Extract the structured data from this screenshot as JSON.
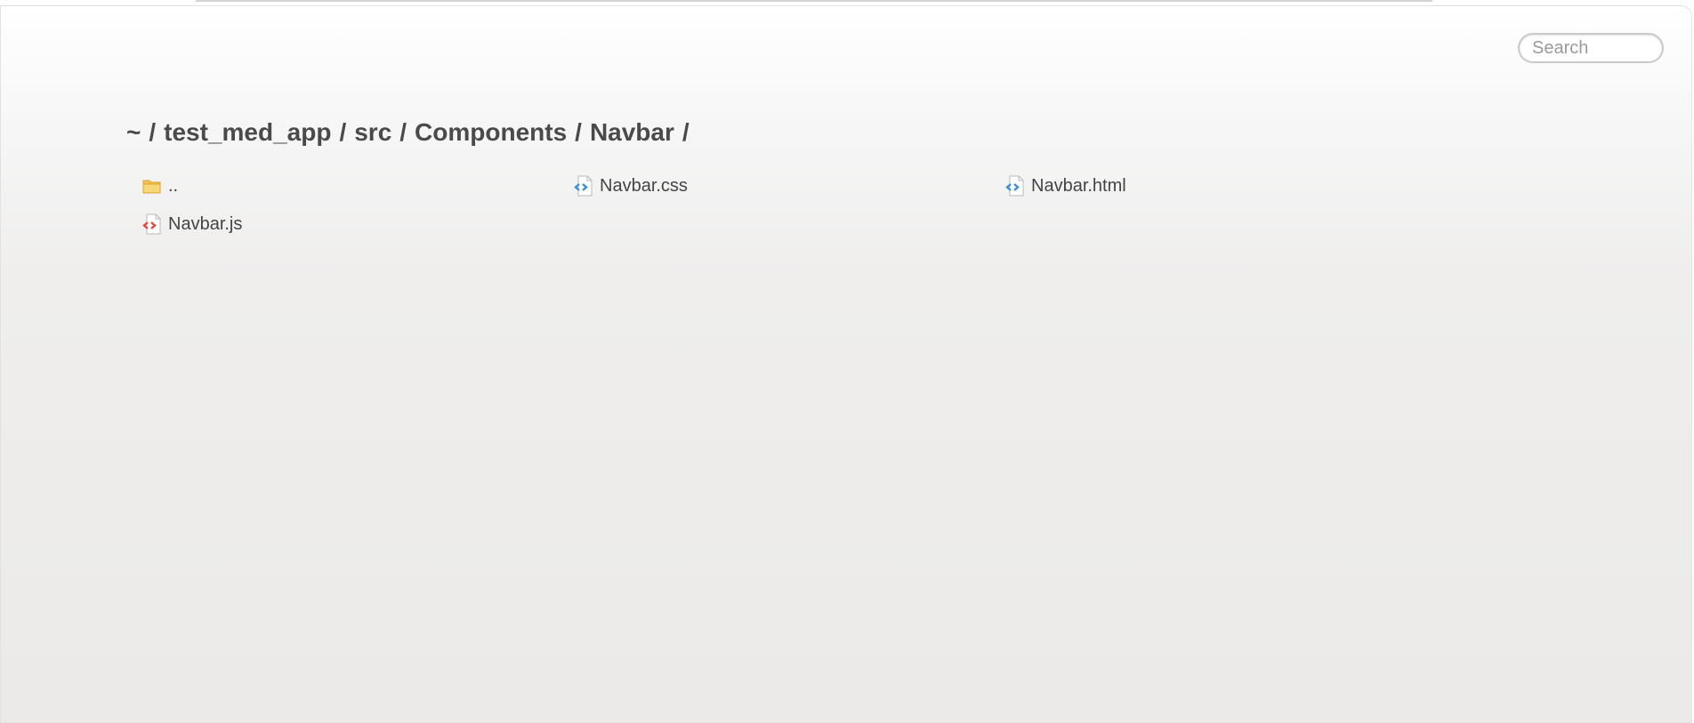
{
  "search": {
    "placeholder": "Search"
  },
  "breadcrumb": {
    "segments": [
      "~",
      "test_med_app",
      "src",
      "Components",
      "Navbar"
    ],
    "separator": "/"
  },
  "files": [
    {
      "name": "..",
      "icon": "folder-icon",
      "type": "folder"
    },
    {
      "name": "Navbar.css",
      "icon": "code-file-icon",
      "type": "css",
      "accent": "#3b8fd9"
    },
    {
      "name": "Navbar.html",
      "icon": "code-file-icon",
      "type": "html",
      "accent": "#3b8fd9"
    },
    {
      "name": "Navbar.js",
      "icon": "code-file-icon",
      "type": "js",
      "accent": "#e04b3f"
    }
  ],
  "colors": {
    "folder": "#f3c24f",
    "code_blue": "#3b8fd9",
    "code_red": "#e04b3f"
  }
}
